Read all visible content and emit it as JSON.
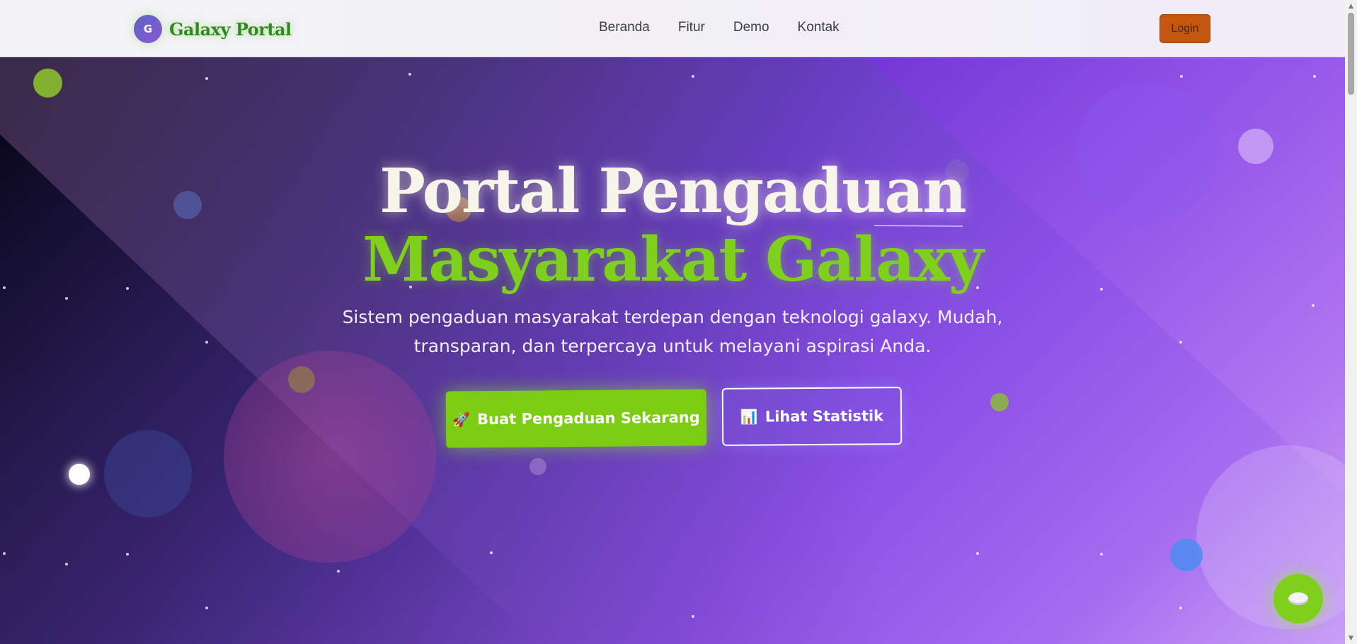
{
  "navbar": {
    "brand_initial": "G",
    "brand_name": "Galaxy Portal",
    "links": [
      "Beranda",
      "Fitur",
      "Demo",
      "Kontak"
    ],
    "login_label": "Login"
  },
  "hero": {
    "title_line1": "Portal Pengaduan",
    "title_line2": "Masyarakat Galaxy",
    "subtitle": "Sistem pengaduan masyarakat terdepan dengan teknologi galaxy. Mudah, transparan, dan terpercaya untuk melayani aspirasi Anda.",
    "primary_button": {
      "icon": "rocket-icon",
      "icon_glyph": "🚀",
      "label": "Buat Pengaduan Sekarang"
    },
    "secondary_button": {
      "icon": "bar-chart-icon",
      "icon_glyph": "📊",
      "label": "Lihat Statistik"
    }
  },
  "chat_fab": {
    "icon": "chat-bubble-icon"
  },
  "colors": {
    "brand_green": "#7fcf1d",
    "login_orange": "#c4560f",
    "hero_purple": "#8a4fe6",
    "nav_bg": "#f4f4f6"
  }
}
